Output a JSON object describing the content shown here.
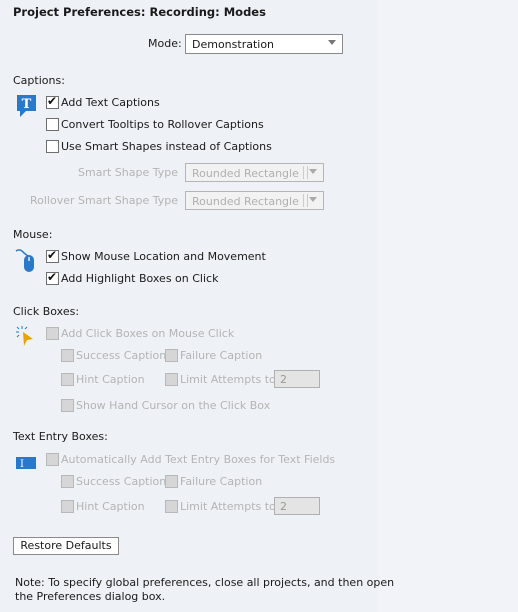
{
  "title": "Project Preferences: Recording: Modes",
  "mode": {
    "label": "Mode:",
    "value": "Demonstration"
  },
  "captions": {
    "heading": "Captions:",
    "icon": "text-caption-icon",
    "add_text": {
      "label": "Add Text Captions",
      "checked": true
    },
    "convert_tooltips": {
      "label": "Convert Tooltips to Rollover Captions",
      "checked": false
    },
    "smart_shapes": {
      "label": "Use Smart Shapes instead of Captions",
      "checked": false
    },
    "smart_shape_type": {
      "label": "Smart Shape Type",
      "value": "Rounded Rectangle"
    },
    "rollover_shape_type": {
      "label": "Rollover Smart Shape Type",
      "value": "Rounded Rectangle"
    }
  },
  "mouse": {
    "heading": "Mouse:",
    "icon": "mouse-icon",
    "show_location": {
      "label": "Show Mouse Location and Movement",
      "checked": true
    },
    "highlight": {
      "label": "Add Highlight Boxes on Click",
      "checked": true
    }
  },
  "click_boxes": {
    "heading": "Click Boxes:",
    "icon": "click-cursor-icon",
    "add": {
      "label": "Add Click Boxes on Mouse Click",
      "checked": false
    },
    "success": "Success Caption",
    "failure": "Failure Caption",
    "hint": "Hint Caption",
    "limit": "Limit Attempts to",
    "limit_value": "2",
    "hand": "Show Hand Cursor on the Click Box"
  },
  "text_entry": {
    "heading": "Text Entry Boxes:",
    "icon": "text-entry-icon",
    "add": {
      "label": "Automatically Add Text Entry Boxes for Text Fields",
      "checked": false
    },
    "success": "Success Caption",
    "failure": "Failure Caption",
    "hint": "Hint Caption",
    "limit": "Limit Attempts to",
    "limit_value": "2"
  },
  "restore_label": "Restore Defaults",
  "note": [
    "Note: To specify global preferences, close all projects, and then open",
    "the Preferences dialog box."
  ]
}
